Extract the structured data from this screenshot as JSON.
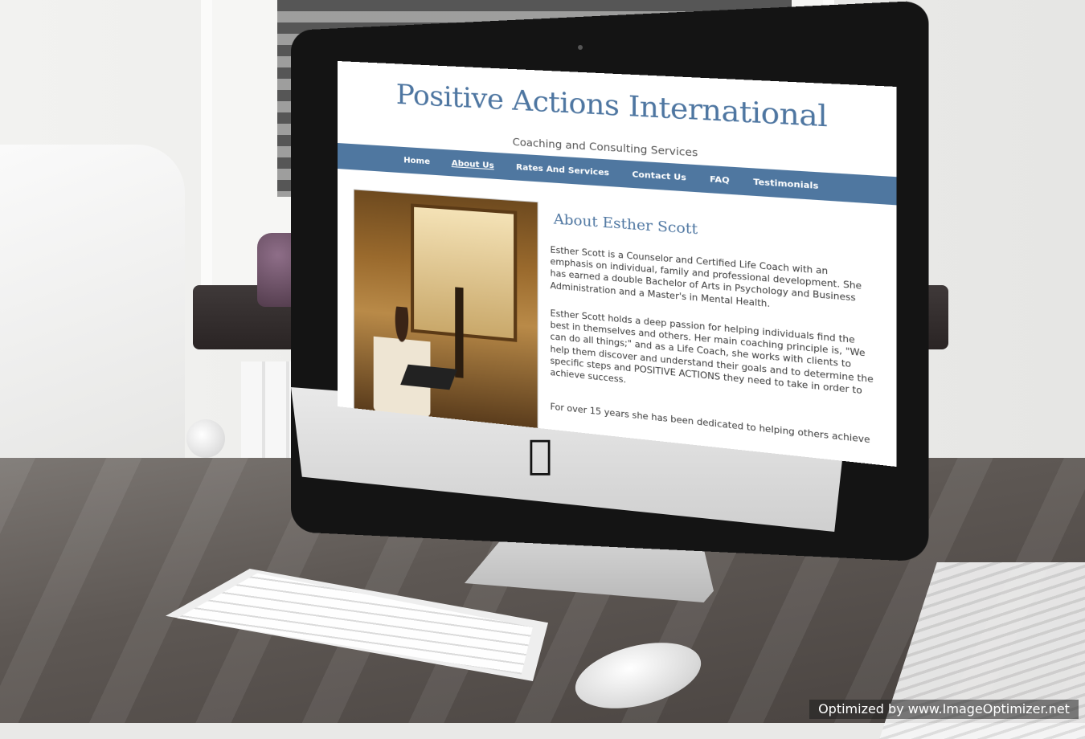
{
  "site": {
    "title": "Positive Actions International",
    "tagline": "Coaching and Consulting Services"
  },
  "nav": {
    "items": [
      {
        "label": "Home",
        "active": false
      },
      {
        "label": "About Us",
        "active": true
      },
      {
        "label": "Rates And Services",
        "active": false
      },
      {
        "label": "Contact Us",
        "active": false
      },
      {
        "label": "FAQ",
        "active": false
      },
      {
        "label": "Testimonials",
        "active": false
      }
    ]
  },
  "about": {
    "heading": "About Esther Scott",
    "paragraph1": "Esther Scott is a Counselor and Certified Life Coach with an emphasis on individual, family and professional development.  She has earned a double Bachelor of Arts in Psychology and Business Administration and a Master's in Mental Health.",
    "paragraph2": "Esther Scott holds a deep passion for helping individuals find the best in themselves and others.  Her main coaching principle is, \"We can do all things;\" and as a Life Coach, she works with clients to help them discover and understand their goals and to determine the specific steps and POSITIVE ACTIONS they need to take in order to achieve success.",
    "paragraph3": "For over 15 years she has been dedicated to helping others achieve"
  },
  "watermark": "Optimized by www.ImageOptimizer.net",
  "colors": {
    "brand_blue": "#4e76a1",
    "nav_bar": "#4f77a0"
  }
}
